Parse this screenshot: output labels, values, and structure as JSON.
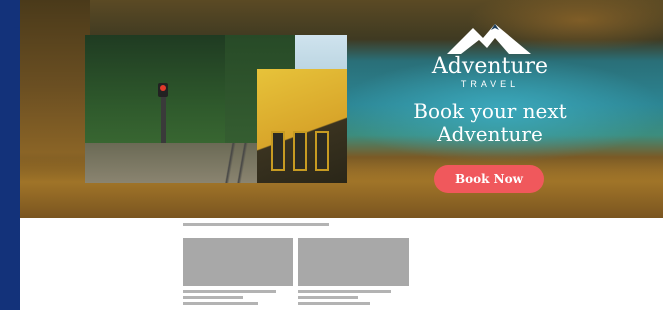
{
  "hero": {
    "brand_title": "Adventure",
    "brand_subtitle": "TRAVEL",
    "headline_line1": "Book your next",
    "headline_line2": "Adventure",
    "cta_label": "Book Now",
    "icons": [
      "mountain-logo-icon"
    ],
    "colors": {
      "cta": "#f0585c",
      "frame": "#13327a"
    }
  },
  "wireframe": {
    "cards": [
      {
        "label": "card-1"
      },
      {
        "label": "card-2"
      }
    ]
  }
}
